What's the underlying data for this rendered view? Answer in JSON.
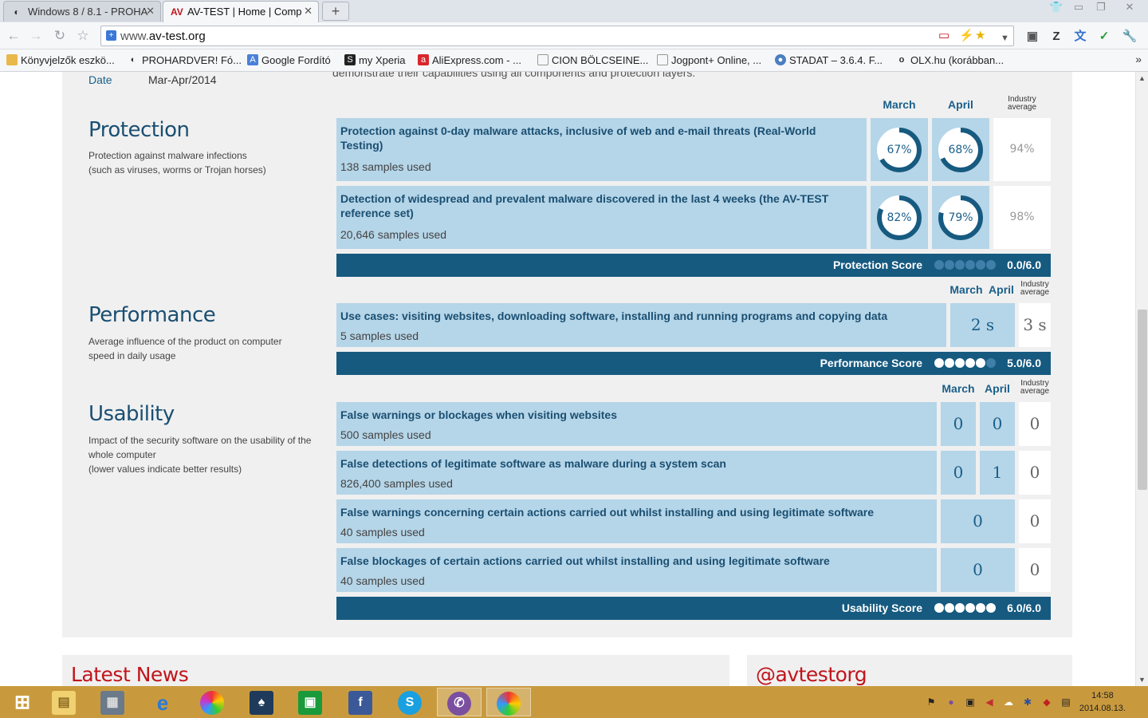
{
  "browser": {
    "tabs": [
      {
        "label": "Windows 8 / 8.1 - PROHA",
        "active": false
      },
      {
        "label": "AV-TEST | Home | Comp",
        "active": true
      }
    ],
    "new_tab_label": "+",
    "url_prefix": "www.",
    "url_domain": "av-test.org",
    "bookmarks": [
      {
        "label": "Könyvjelzők eszkö...",
        "icon": "folder-icon"
      },
      {
        "label": "PROHARDVER! Fó...",
        "icon": "prohardver-icon"
      },
      {
        "label": "Google Fordító",
        "icon": "translate-icon"
      },
      {
        "label": "my Xperia",
        "icon": "xperia-icon"
      },
      {
        "label": "AliExpress.com - ...",
        "icon": "aliexpress-icon"
      },
      {
        "label": "CION BÖLCSEINE...",
        "icon": "page-icon"
      },
      {
        "label": "Jogpont+ Online, ...",
        "icon": "page-icon"
      },
      {
        "label": "STADAT – 3.6.4. F...",
        "icon": "stadat-icon"
      },
      {
        "label": "OLX.hu (korábban...",
        "icon": "olx-icon"
      }
    ]
  },
  "page": {
    "date_label": "Date",
    "date_value": "Mar-Apr/2014",
    "intro_text": "demonstrate their capabilities using all components and protection layers.",
    "colors": {
      "accent": "#1a5f8a",
      "row_bg": "#b5d5e8",
      "score_bar": "#165a80",
      "news_red": "#c0151c"
    },
    "columns": {
      "march": "March",
      "april": "April",
      "industry": "Industry average",
      "industry_l1": "Industry",
      "industry_l2": "average"
    },
    "protection": {
      "title": "Protection",
      "desc_l1": "Protection against malware infections",
      "desc_l2": "(such as viruses, worms or Trojan horses)",
      "rows": [
        {
          "title": "Protection against 0-day malware attacks, inclusive of web and e-mail threats (Real-World Testing)",
          "samples": "138 samples used",
          "march": "67%",
          "april": "68%",
          "industry": "94%",
          "march_value": 67,
          "april_value": 68
        },
        {
          "title": "Detection of widespread and prevalent malware discovered in the last 4 weeks (the AV-TEST reference set)",
          "samples": "20,646 samples used",
          "march": "82%",
          "april": "79%",
          "industry": "98%",
          "march_value": 82,
          "april_value": 79
        }
      ],
      "score_label": "Protection Score",
      "score_value": "0.0/6.0",
      "score_dots": 0
    },
    "performance": {
      "title": "Performance",
      "desc_l1": "Average influence of the product on computer",
      "desc_l2": "speed in daily usage",
      "rows": [
        {
          "title": "Use cases: visiting websites, downloading software, installing and running programs and copying data",
          "samples": "5 samples used",
          "marchapril": "2 s",
          "industry": "3 s"
        }
      ],
      "score_label": "Performance Score",
      "score_value": "5.0/6.0",
      "score_dots": 5
    },
    "usability": {
      "title": "Usability",
      "desc_l1": "Impact of the security software on the usability of the",
      "desc_l2": "whole computer",
      "desc_l3": "(lower values indicate better results)",
      "rows": [
        {
          "title": "False warnings or blockages when visiting websites",
          "samples": "500 samples used",
          "march": "0",
          "april": "0",
          "industry": "0"
        },
        {
          "title": "False detections of legitimate software as malware during a system scan",
          "samples": "826,400 samples used",
          "march": "0",
          "april": "1",
          "industry": "0"
        },
        {
          "title": "False warnings concerning certain actions carried out whilst installing and using legitimate software",
          "samples": "40 samples used",
          "marchapril": "0",
          "industry": "0"
        },
        {
          "title": "False blockages of certain actions carried out whilst installing and using legitimate software",
          "samples": "40 samples used",
          "marchapril": "0",
          "industry": "0"
        }
      ],
      "score_label": "Usability Score",
      "score_value": "6.0/6.0",
      "score_dots": 6
    },
    "latest_news_title": "Latest News",
    "twitter_title": "@avtestorg"
  },
  "taskbar": {
    "apps": [
      "start-icon",
      "explorer-icon",
      "mahjong-icon",
      "ie-icon",
      "picasa-icon",
      "solitaire-icon",
      "store-icon",
      "facebook-icon",
      "skype-icon",
      "viber-icon",
      "chrome-icon"
    ],
    "time": "14:58",
    "date": "2014.08.13."
  }
}
